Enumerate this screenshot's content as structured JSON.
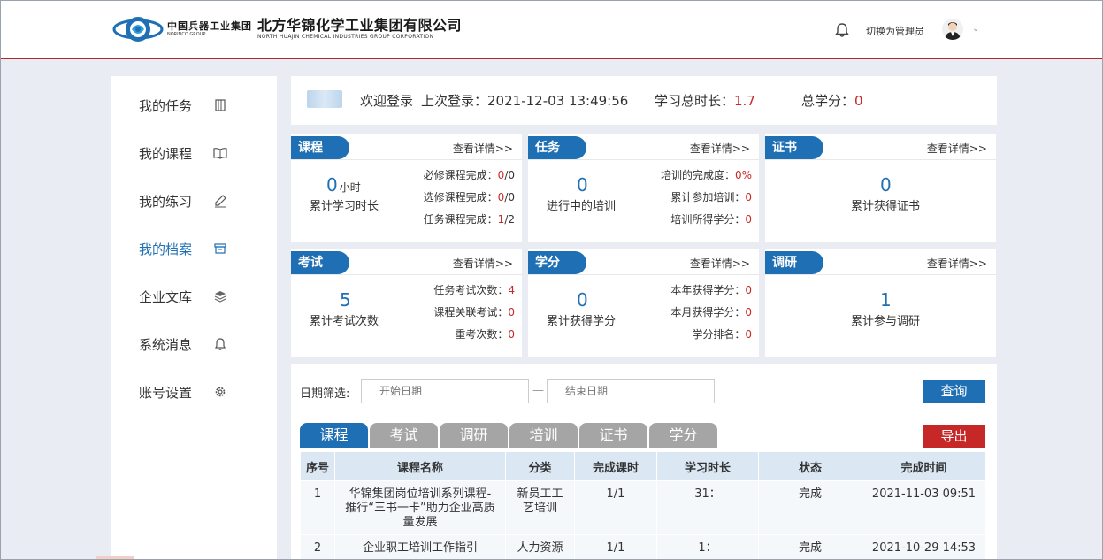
{
  "header": {
    "brand_cn": "中国兵器工业集团",
    "brand_en": "NORINCO GROUP",
    "company_cn": "北方华锦化学工业集团有限公司",
    "company_en": "NORTH HUAJIN CHEMICAL INDUSTRIES GROUP CORPORATION",
    "switch_admin": "切换为管理员",
    "caret": "⌄"
  },
  "sidebar": {
    "items": [
      {
        "label": "我的任务",
        "icon": "book-icon"
      },
      {
        "label": "我的课程",
        "icon": "open-book-icon"
      },
      {
        "label": "我的练习",
        "icon": "pencil-icon"
      },
      {
        "label": "我的档案",
        "icon": "archive-icon"
      },
      {
        "label": "企业文库",
        "icon": "layers-icon"
      },
      {
        "label": "系统消息",
        "icon": "bell-icon"
      },
      {
        "label": "账号设置",
        "icon": "gear-icon"
      }
    ],
    "active": "我的档案"
  },
  "welcome": {
    "greeting": "欢迎登录",
    "last_login_label": "上次登录：",
    "last_login_value": "2021-12-03 13:49:56",
    "study_total_label": "学习总时长：",
    "study_total_value": "1.7",
    "credits_label": "总学分：",
    "credits_value": "0"
  },
  "more_label": "查看详情>>",
  "cards": {
    "course": {
      "tag": "课程",
      "big_value": "0",
      "big_unit": "小时",
      "big_label": "累计学习时长",
      "rows": [
        {
          "label": "必修课程完成：",
          "value": "0",
          "suffix": "/0"
        },
        {
          "label": "选修课程完成：",
          "value": "0",
          "suffix": "/0"
        },
        {
          "label": "任务课程完成：",
          "value": "1",
          "suffix": "/2"
        }
      ]
    },
    "task": {
      "tag": "任务",
      "big_value": "0",
      "big_label": "进行中的培训",
      "rows": [
        {
          "label": "培训的完成度：",
          "value": "0%"
        },
        {
          "label": "累计参加培训：",
          "value": "0"
        },
        {
          "label": "培训所得学分：",
          "value": "0"
        }
      ]
    },
    "cert": {
      "tag": "证书",
      "big_value": "0",
      "big_label": "累计获得证书"
    },
    "exam": {
      "tag": "考试",
      "big_value": "5",
      "big_label": "累计考试次数",
      "rows": [
        {
          "label": "任务考试次数：",
          "value": "4"
        },
        {
          "label": "课程关联考试：",
          "value": "0"
        },
        {
          "label": "重考次数：",
          "value": "0"
        }
      ]
    },
    "credit": {
      "tag": "学分",
      "big_value": "0",
      "big_label": "累计获得学分",
      "rows": [
        {
          "label": "本年获得学分：",
          "value": "0"
        },
        {
          "label": "本月获得学分：",
          "value": "0"
        },
        {
          "label": "学分排名：",
          "value": "0"
        }
      ]
    },
    "survey": {
      "tag": "调研",
      "big_value": "1",
      "big_label": "累计参与调研"
    }
  },
  "filter": {
    "label": "日期筛选:",
    "start_placeholder": "开始日期",
    "end_placeholder": "结束日期",
    "dash": "—",
    "query_button": "查询",
    "export_button": "导出"
  },
  "tabs": [
    "课程",
    "考试",
    "调研",
    "培训",
    "证书",
    "学分"
  ],
  "table": {
    "headers": [
      "序号",
      "课程名称",
      "分类",
      "完成课时",
      "学习时长",
      "状态",
      "完成时间"
    ],
    "rows": [
      [
        "1",
        "华锦集团岗位培训系列课程-推行“三书一卡”助力企业高质量发展",
        "新员工工艺培训",
        "1/1",
        "31：",
        "完成",
        "2021-11-03 09:51"
      ],
      [
        "2",
        "企业职工培训工作指引",
        "人力资源",
        "1/1",
        "1：",
        "完成",
        "2021-10-29 14:53"
      ]
    ]
  },
  "colors": {
    "accent": "#1f6fb4",
    "danger": "#c62828",
    "tab_inactive": "#a5a5a5",
    "header_rule": "#b3282d"
  }
}
